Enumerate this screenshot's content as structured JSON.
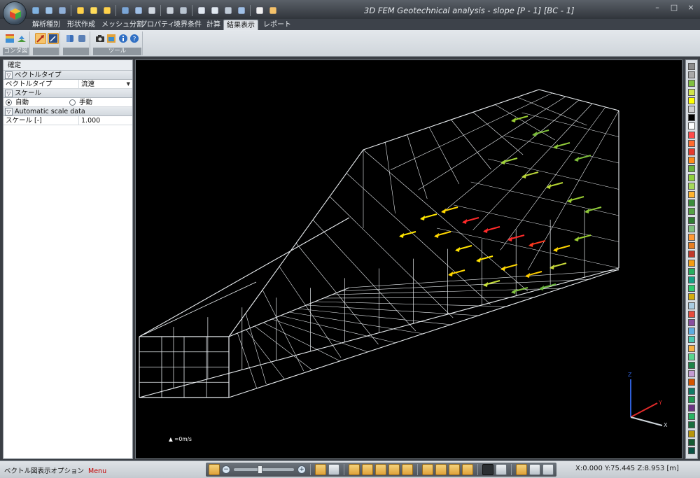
{
  "window": {
    "title": "3D FEM Geotechnical analysis - slope [P - 1] [BC - 1]",
    "controls": [
      "–",
      "□",
      "×"
    ]
  },
  "quick_access_icons": [
    "open-icon",
    "save-icon",
    "copy-icon",
    "light-icon",
    "sun-icon",
    "sun-icon",
    "view-icon",
    "select-icon",
    "pin-icon",
    "camera-icon",
    "grid-icon",
    "circle-icon",
    "square-icon",
    "move-icon",
    "rotate-icon",
    "cursor-icon",
    "pointer-icon"
  ],
  "tabs": [
    "解析種別",
    "形状作成",
    "メッシュ分割",
    "プロパティ",
    "境界条件",
    "計算",
    "結果表示",
    "レポート"
  ],
  "active_tab": "結果表示",
  "ribbon": {
    "groups": [
      {
        "label": "コンタ図"
      },
      {
        "label": ""
      },
      {
        "label": ""
      },
      {
        "label": "ツール"
      }
    ]
  },
  "panel": {
    "header": "確定",
    "sections": {
      "vector_type": "ベクトルタイプ",
      "scale": "スケール",
      "auto_scale": "Automatic scale data"
    },
    "vector_type_row": {
      "name": "ベクトルタイプ",
      "value": "流速"
    },
    "scale_options": {
      "auto": "自動",
      "manual": "手動",
      "selected": "auto"
    },
    "scale_row": {
      "name": "スケール [-]",
      "value": "1.000"
    }
  },
  "viewport": {
    "legend_label": "=0m/s",
    "axes": {
      "x": "X",
      "y": "Y",
      "z": "Z"
    }
  },
  "palette_colors": [
    "#8c8c8c",
    "#a8a8a8",
    "#7fbf3f",
    "#cfe34a",
    "#ffff00",
    "#cccccc",
    "#000000",
    "#ffffff",
    "#ff4a4a",
    "#ff6b2e",
    "#e63b2e",
    "#ff8c1a",
    "#69b33c",
    "#8fcf3c",
    "#a6d95a",
    "#ffb32e",
    "#3a8c3a",
    "#55a344",
    "#2e7d32",
    "#7fbf7f",
    "#ff9933",
    "#e67e22",
    "#c0392b",
    "#f39c12",
    "#27ae60",
    "#16a085",
    "#2ecc71",
    "#d4ac0d",
    "#a9cce3",
    "#e74c3c",
    "#884ea0",
    "#5dade2",
    "#48c9b0",
    "#f5b041",
    "#58d68d",
    "#1e8449",
    "#c39bd3",
    "#d35400",
    "#117a65",
    "#229954",
    "#6c3483",
    "#28b463",
    "#196f3d",
    "#b7950b",
    "#145a32",
    "#0b5345"
  ],
  "status": {
    "left_text": "ベクトル図表示オプション",
    "menu": "Menu",
    "coordinates": "X:0.000 Y:75.445 Z:8.953 [m]"
  }
}
